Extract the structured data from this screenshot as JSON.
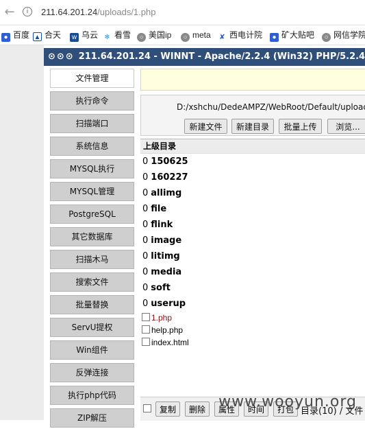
{
  "browser": {
    "url_host": "211.64.201.24",
    "url_path": "/uploads/1.php",
    "bookmarks": [
      {
        "label": "百度",
        "icon": "baidu-icon"
      },
      {
        "label": "合天",
        "icon": "shield-icon"
      },
      {
        "label": "乌云",
        "icon": "wooyun-icon"
      },
      {
        "label": "看雪",
        "icon": "snowflake-icon"
      },
      {
        "label": "美国ip",
        "icon": "globe-icon"
      },
      {
        "label": "meta",
        "icon": "globe-icon"
      },
      {
        "label": "西电计院",
        "icon": "xidian-icon"
      },
      {
        "label": "矿大贴吧",
        "icon": "baidu-icon"
      },
      {
        "label": "网信学院",
        "icon": "globe-icon"
      }
    ]
  },
  "title": "211.64.201.24 - WINNT - Apache/2.2.4 (Win32) PHP/5.2.4",
  "menu": [
    "文件管理",
    "执行命令",
    "扫描端口",
    "系统信息",
    "MYSQL执行",
    "MYSQL管理",
    "PostgreSQL",
    "其它数据库",
    "扫描木马",
    "搜索文件",
    "批量替换",
    "ServU提权",
    "Win组件",
    "反弹连接",
    "执行php代码",
    "ZIP解压"
  ],
  "path": "D:/xshchu/DedeAMPZ/WebRoot/Default/uploads",
  "actions": [
    "新建文件",
    "新建目录",
    "批量上传",
    "浏览..."
  ],
  "list_header": "上级目录",
  "dirs": [
    {
      "count": "0",
      "name": "150625"
    },
    {
      "count": "0",
      "name": "160227"
    },
    {
      "count": "0",
      "name": "allimg"
    },
    {
      "count": "0",
      "name": "file"
    },
    {
      "count": "0",
      "name": "flink"
    },
    {
      "count": "0",
      "name": "image"
    },
    {
      "count": "0",
      "name": "litimg"
    },
    {
      "count": "0",
      "name": "media"
    },
    {
      "count": "0",
      "name": "soft"
    },
    {
      "count": "0",
      "name": "userup"
    }
  ],
  "files": [
    "1.php",
    "help.php",
    "index.html"
  ],
  "bottom_buttons": [
    "复制",
    "删除",
    "属性",
    "时间",
    "打包"
  ],
  "dir_info": "目录(10) / 文件",
  "watermark": "www.wooyun.org"
}
